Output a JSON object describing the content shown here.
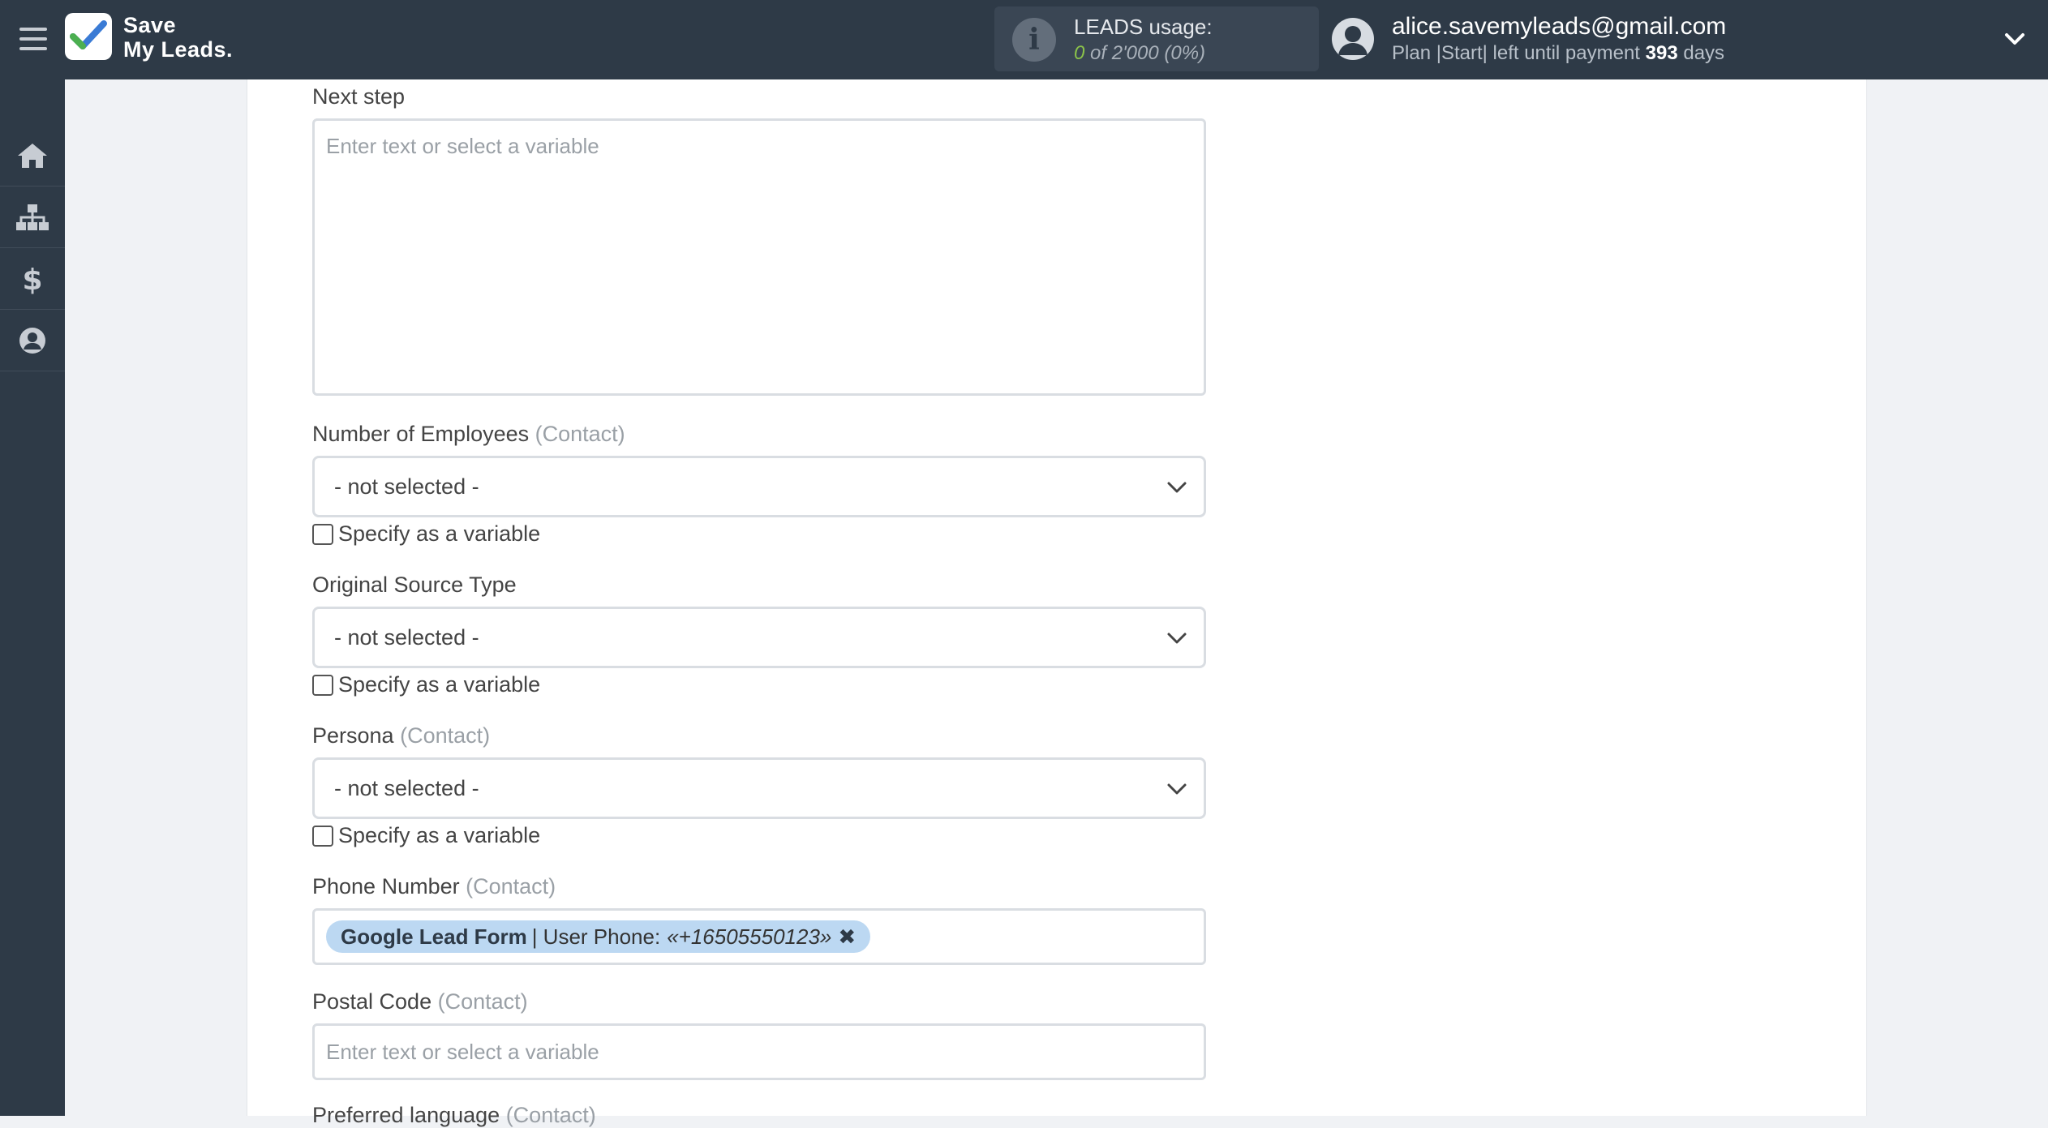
{
  "app": {
    "logo_line1": "Save",
    "logo_line2": "My Leads."
  },
  "usage": {
    "title": "LEADS usage:",
    "used": "0",
    "total_text": "of 2'000",
    "percent_text": "(0%)"
  },
  "user": {
    "email": "alice.savemyleads@gmail.com",
    "plan_prefix": "Plan |Start| left until payment",
    "days": "393",
    "days_suffix": "days"
  },
  "sidebar": {
    "items": [
      {
        "icon": "home-icon"
      },
      {
        "icon": "sitemap-icon"
      },
      {
        "icon": "dollar-icon"
      },
      {
        "icon": "user-circle-icon"
      }
    ]
  },
  "form": {
    "next_step": {
      "label": "Next step",
      "placeholder": "Enter text or select a variable"
    },
    "employees": {
      "label": "Number of Employees",
      "sub": "(Contact)",
      "value": "- not selected -",
      "checkbox_label": "Specify as a variable"
    },
    "source_type": {
      "label": "Original Source Type",
      "value": "- not selected -",
      "checkbox_label": "Specify as a variable"
    },
    "persona": {
      "label": "Persona",
      "sub": "(Contact)",
      "value": "- not selected -",
      "checkbox_label": "Specify as a variable"
    },
    "phone": {
      "label": "Phone Number",
      "sub": "(Contact)",
      "tag_source": "Google Lead Form",
      "tag_separator": "| User Phone:",
      "tag_value": "«+16505550123»",
      "tag_remove": "✖"
    },
    "postal": {
      "label": "Postal Code",
      "sub": "(Contact)",
      "placeholder": "Enter text or select a variable"
    },
    "language": {
      "label": "Preferred language",
      "sub": "(Contact)"
    }
  },
  "colors": {
    "topbar": "#2e3a47",
    "accent_green": "#8bc34a",
    "tag_bg": "#bcd8f2"
  }
}
